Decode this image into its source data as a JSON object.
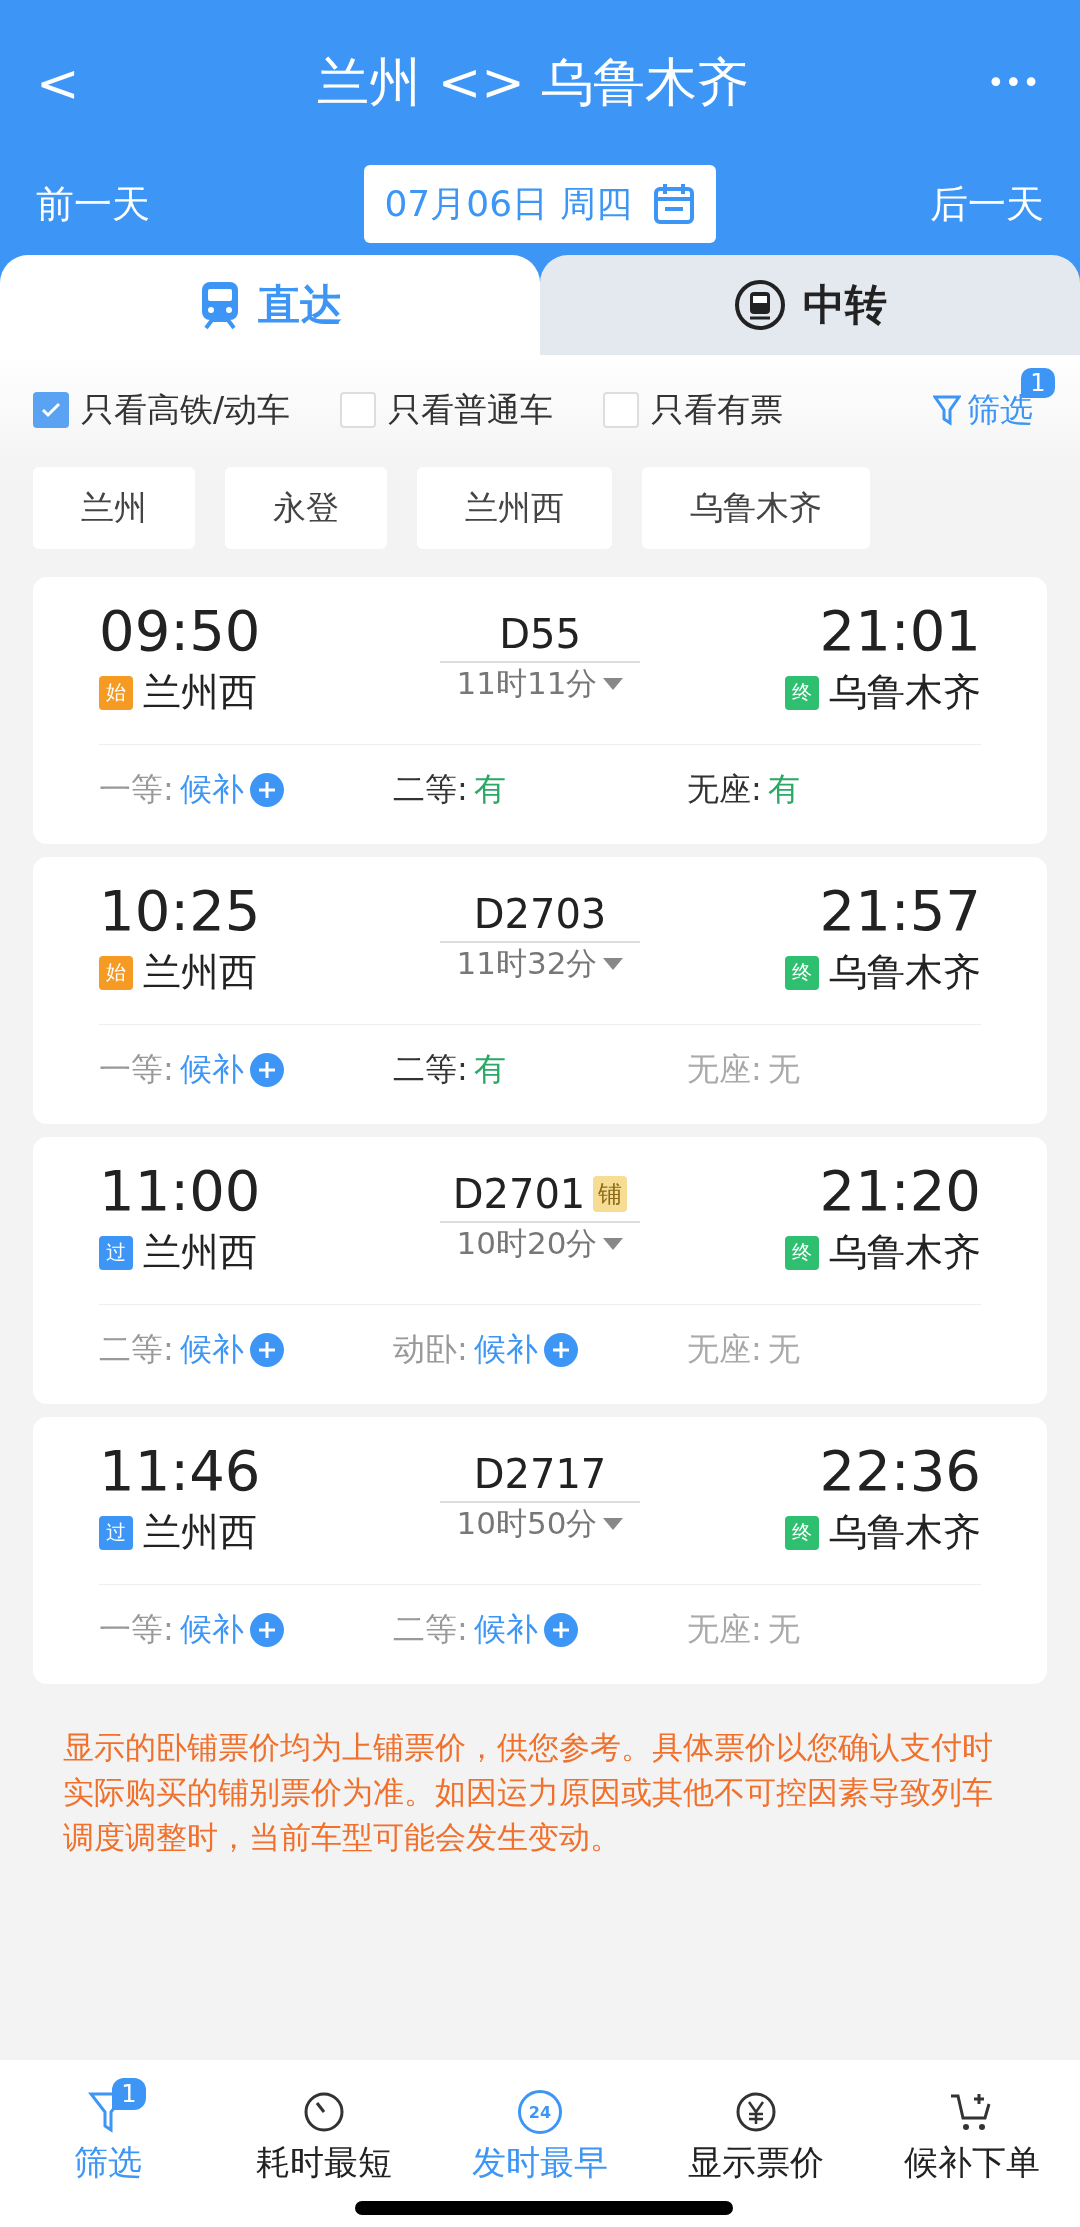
{
  "header": {
    "back": "<",
    "title": "兰州 <> 乌鲁木齐",
    "more": "•••",
    "prev_day": "前一天",
    "date": "07月06日 周四",
    "next_day": "后一天"
  },
  "tabs": [
    {
      "label": "直达",
      "kind": "direct",
      "selected": true
    },
    {
      "label": "中转",
      "kind": "transfer",
      "selected": false
    }
  ],
  "filters": [
    {
      "label": "只看高铁/动车",
      "checked": true
    },
    {
      "label": "只看普通车",
      "checked": false
    },
    {
      "label": "只看有票",
      "checked": false
    }
  ],
  "filter_link": {
    "label": "筛选",
    "badge": "1"
  },
  "stations": [
    "兰州",
    "永登",
    "兰州西",
    "乌鲁木齐"
  ],
  "trains": [
    {
      "depart": "09:50",
      "from_tag": {
        "kind": "start",
        "text": "始"
      },
      "from": "兰州西",
      "number": "D55",
      "duration": "11时11分",
      "arrive": "21:01",
      "to_tag": {
        "kind": "end",
        "text": "终"
      },
      "to": "乌鲁木齐",
      "seats": [
        {
          "label": "一等:",
          "status": "候补",
          "kind": "waitlist"
        },
        {
          "label": "二等:",
          "status": "有",
          "kind": "available"
        },
        {
          "label": "无座:",
          "status": "有",
          "kind": "available"
        }
      ]
    },
    {
      "depart": "10:25",
      "from_tag": {
        "kind": "start",
        "text": "始"
      },
      "from": "兰州西",
      "number": "D2703",
      "duration": "11时32分",
      "arrive": "21:57",
      "to_tag": {
        "kind": "end",
        "text": "终"
      },
      "to": "乌鲁木齐",
      "seats": [
        {
          "label": "一等:",
          "status": "候补",
          "kind": "waitlist"
        },
        {
          "label": "二等:",
          "status": "有",
          "kind": "available"
        },
        {
          "label": "无座:",
          "status": "无",
          "kind": "none"
        }
      ]
    },
    {
      "depart": "11:00",
      "from_tag": {
        "kind": "pass",
        "text": "过"
      },
      "from": "兰州西",
      "number": "D2701",
      "berth": "铺",
      "duration": "10时20分",
      "arrive": "21:20",
      "to_tag": {
        "kind": "end",
        "text": "终"
      },
      "to": "乌鲁木齐",
      "seats": [
        {
          "label": "二等:",
          "status": "候补",
          "kind": "waitlist"
        },
        {
          "label": "动卧:",
          "status": "候补",
          "kind": "waitlist"
        },
        {
          "label": "无座:",
          "status": "无",
          "kind": "none"
        }
      ]
    },
    {
      "depart": "11:46",
      "from_tag": {
        "kind": "pass",
        "text": "过"
      },
      "from": "兰州西",
      "number": "D2717",
      "duration": "10时50分",
      "arrive": "22:36",
      "to_tag": {
        "kind": "end",
        "text": "终"
      },
      "to": "乌鲁木齐",
      "seats": [
        {
          "label": "一等:",
          "status": "候补",
          "kind": "waitlist"
        },
        {
          "label": "二等:",
          "status": "候补",
          "kind": "waitlist"
        },
        {
          "label": "无座:",
          "status": "无",
          "kind": "none"
        }
      ]
    }
  ],
  "notice": "显示的卧铺票价均为上铺票价，供您参考。具体票价以您确认支付时实际购买的铺别票价为准。如因运力原因或其他不可控因素导致列车调度调整时，当前车型可能会发生变动。",
  "bottom_bar": [
    {
      "label": "筛选",
      "kind": "filter",
      "badge": "1",
      "selected": true
    },
    {
      "label": "耗时最短",
      "kind": "timer",
      "selected": false
    },
    {
      "label": "发时最早",
      "kind": "clock24",
      "icon_text": "24",
      "selected": true
    },
    {
      "label": "显示票价",
      "kind": "price",
      "selected": false
    },
    {
      "label": "候补下单",
      "kind": "cart",
      "selected": false
    }
  ]
}
